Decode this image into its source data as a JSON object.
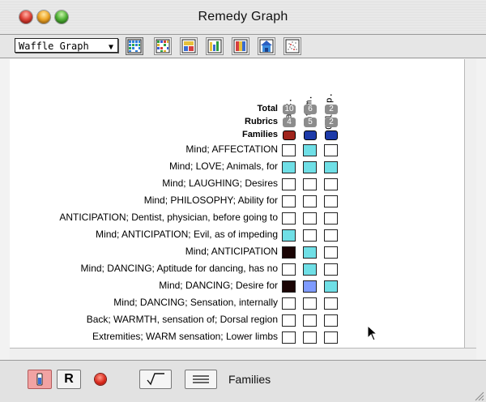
{
  "window": {
    "title": "Remedy Graph"
  },
  "toolbar": {
    "graph_type": "Waffle Graph",
    "buttons": [
      {
        "name": "waffle-view-icon",
        "active": true
      },
      {
        "name": "grid-view-icon",
        "active": false
      },
      {
        "name": "table-view-icon",
        "active": false
      },
      {
        "name": "bar-view-icon",
        "active": false
      },
      {
        "name": "column-view-icon",
        "active": false
      },
      {
        "name": "house-view-icon",
        "active": false
      },
      {
        "name": "scatter-view-icon",
        "active": false
      }
    ]
  },
  "graph": {
    "remedies": [
      {
        "name": "Carc.",
        "total": "10",
        "rubrics": "4",
        "family_color": "#a0241c"
      },
      {
        "name": "Nat-m.",
        "total": "6",
        "rubrics": "5",
        "family_color": "#1d3aa8"
      },
      {
        "name": "Calc-p.",
        "total": "2",
        "rubrics": "2",
        "family_color": "#1d3aa8"
      }
    ],
    "row_labels": {
      "total": "Total",
      "rubrics": "Rubrics",
      "families": "Families"
    },
    "rubrics": [
      {
        "label": "Mind; AFFECTATION",
        "cells": [
          "empty",
          "cyan",
          "empty"
        ]
      },
      {
        "label": "Mind; LOVE; Animals, for",
        "cells": [
          "cyan",
          "cyan",
          "cyan"
        ]
      },
      {
        "label": "Mind; LAUGHING; Desires",
        "cells": [
          "empty",
          "empty",
          "empty"
        ]
      },
      {
        "label": "Mind; PHILOSOPHY; Ability for",
        "cells": [
          "empty",
          "empty",
          "empty"
        ]
      },
      {
        "label": "ANTICIPATION; Dentist, physician, before going to",
        "cells": [
          "empty",
          "empty",
          "empty"
        ]
      },
      {
        "label": "Mind; ANTICIPATION; Evil, as of impeding",
        "cells": [
          "cyan",
          "empty",
          "empty"
        ]
      },
      {
        "label": "Mind; ANTICIPATION",
        "cells": [
          "black",
          "cyan",
          "empty"
        ]
      },
      {
        "label": "Mind; DANCING; Aptitude for dancing, has no",
        "cells": [
          "empty",
          "cyan",
          "empty"
        ]
      },
      {
        "label": "Mind; DANCING; Desire for",
        "cells": [
          "black",
          "blue",
          "cyan"
        ]
      },
      {
        "label": "Mind; DANCING; Sensation, internally",
        "cells": [
          "empty",
          "empty",
          "empty"
        ]
      },
      {
        "label": "Back; WARMTH, sensation of; Dorsal region",
        "cells": [
          "empty",
          "empty",
          "empty"
        ]
      },
      {
        "label": "Extremities; WARM sensation; Lower limbs",
        "cells": [
          "empty",
          "empty",
          "empty"
        ]
      }
    ],
    "cell_colors": {
      "empty": "#ffffff",
      "cyan": "#6fdfe6",
      "blue": "#7f9bff",
      "black": "#1a0505"
    }
  },
  "bottombar": {
    "r_button": "R",
    "label": "Families"
  }
}
